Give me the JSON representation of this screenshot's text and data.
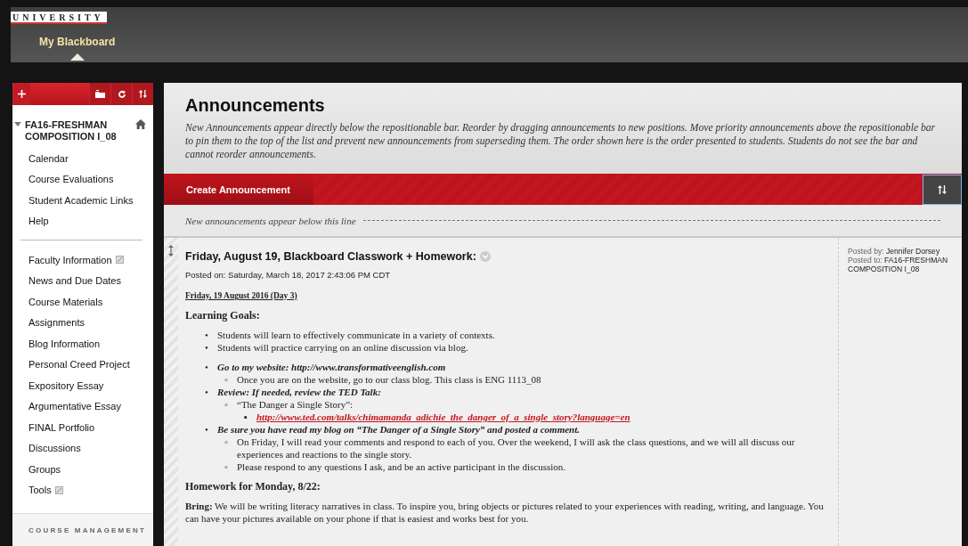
{
  "header": {
    "logo": "UNIVERSITY",
    "tabs": [
      {
        "label": "My Blackboard",
        "selected": true
      }
    ]
  },
  "sidebar": {
    "course": {
      "title": "FA16-FRESHMAN COMPOSITION I_08",
      "expanded": true
    },
    "groups": [
      [
        {
          "label": "Calendar",
          "restricted": false
        },
        {
          "label": "Course Evaluations",
          "restricted": false
        },
        {
          "label": "Student Academic Links",
          "restricted": false
        },
        {
          "label": "Help",
          "restricted": false
        }
      ],
      [
        {
          "label": "Faculty Information",
          "restricted": true
        },
        {
          "label": "News and Due Dates",
          "restricted": false
        },
        {
          "label": "Course Materials",
          "restricted": false
        },
        {
          "label": "Assignments",
          "restricted": false
        },
        {
          "label": "Blog Information",
          "restricted": false
        },
        {
          "label": "Personal Creed Project",
          "restricted": false
        },
        {
          "label": "Expository Essay",
          "restricted": false
        },
        {
          "label": "Argumentative Essay",
          "restricted": false
        },
        {
          "label": "FINAL Portfolio",
          "restricted": false
        },
        {
          "label": "Discussions",
          "restricted": false
        },
        {
          "label": "Groups",
          "restricted": false
        },
        {
          "label": "Tools",
          "restricted": true
        }
      ]
    ],
    "footer": "COURSE MANAGEMENT"
  },
  "main": {
    "title": "Announcements",
    "description": "New Announcements appear directly below the repositionable bar. Reorder by dragging announcements to new positions. Move priority announcements above the repositionable bar to pin them to the top of the list and prevent new announcements from superseding them. The order shown here is the order presented to students. Students do not see the bar and cannot reorder announcements.",
    "create_button": "Create Announcement",
    "divider_note": "New announcements appear below this line",
    "announcement": {
      "title": "Friday, August 19, Blackboard Classwork + Homework:",
      "posted_on": "Posted on: Saturday, March 18, 2017 2:43:06 PM CDT",
      "posted_by_label": "Posted by:",
      "posted_by": "Jennifer Dorsey",
      "posted_to_label": "Posted to:",
      "posted_to": "FA16-FRESHMAN COMPOSITION I_08",
      "body": [
        {
          "kind": "date",
          "text": "Friday, 19 August 2016 (Day 3)"
        },
        {
          "kind": "heading",
          "text": "Learning Goals:"
        },
        {
          "kind": "list",
          "items": [
            {
              "kind": "plain",
              "marker": "•",
              "text": "Students will learn to effectively communicate in a variety of  contexts."
            },
            {
              "kind": "plain",
              "marker": "•",
              "text": "Students will practice carrying on an online discussion via blog."
            }
          ]
        },
        {
          "kind": "list",
          "items": [
            {
              "kind": "emphasis",
              "marker": "•",
              "text": "Go to my website: http://www.transformativeenglish.com",
              "children": [
                {
                  "kind": "plain",
                  "marker": "◦",
                  "text": "Once you are on the website, go to our class blog. This class is ENG 1113_08"
                }
              ]
            },
            {
              "kind": "emphasis",
              "marker": "•",
              "text": "Review: If  needed, review the TED Talk:",
              "children": [
                {
                  "kind": "plain",
                  "marker": "◦",
                  "text": "“The Danger a Single Story”:",
                  "children": [
                    {
                      "kind": "link",
                      "marker": "▪",
                      "text": "http://www.ted.com/talks/chimamanda_adichie_the_danger_of_a_single_story?language=en"
                    }
                  ]
                }
              ]
            },
            {
              "kind": "emphasis",
              "marker": "•",
              "text": "Be sure you have read my blog on “The Danger of  a Single Story” and posted a comment.",
              "children": [
                {
                  "kind": "plain",
                  "marker": "◦",
                  "text": "On Friday, I will read your comments and respond to each of  you. Over the weekend, I will ask the class questions, and we will all discuss our experiences and reactions to the single story."
                },
                {
                  "kind": "plain",
                  "marker": "◦",
                  "text": "Please respond to any questions I ask, and be an active participant in the discussion."
                }
              ]
            }
          ]
        },
        {
          "kind": "heading",
          "text": "Homework for Monday, 8/22:"
        },
        {
          "kind": "paragraph",
          "text": "**Bring:** We will be writing literacy narratives in class. To inspire you, bring objects or pictures related to your experiences with reading, writing, and language. You can have your pictures available on your phone if  that is easiest and works best for you."
        }
      ]
    }
  }
}
